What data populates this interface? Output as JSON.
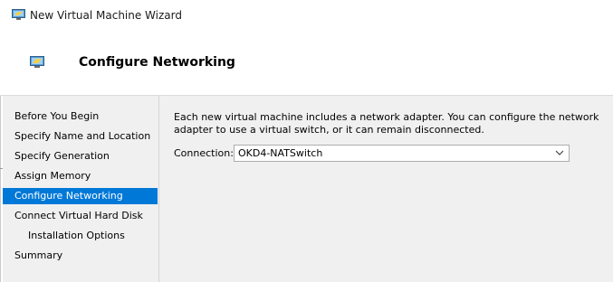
{
  "window": {
    "title": "New Virtual Machine Wizard"
  },
  "header": {
    "title": "Configure Networking"
  },
  "nav": {
    "items": [
      {
        "label": "Before You Begin"
      },
      {
        "label": "Specify Name and Location"
      },
      {
        "label": "Specify Generation"
      },
      {
        "label": "Assign Memory"
      },
      {
        "label": "Configure Networking",
        "selected": true
      },
      {
        "label": "Connect Virtual Hard Disk"
      },
      {
        "label": "Installation Options",
        "indented": true
      },
      {
        "label": "Summary"
      }
    ]
  },
  "content": {
    "description": "Each new virtual machine includes a network adapter. You can configure the network adapter to use a virtual switch, or it can remain disconnected.",
    "connection_label": "Connection:",
    "connection_value": "OKD4-NATSwitch"
  },
  "colors": {
    "accent": "#0078d7",
    "panel_background": "#f0f0f0",
    "header_background": "#ffffff"
  },
  "icons": {
    "window": "virtual-machine-icon",
    "header": "virtual-machine-icon",
    "dropdown": "chevron-down-icon"
  }
}
